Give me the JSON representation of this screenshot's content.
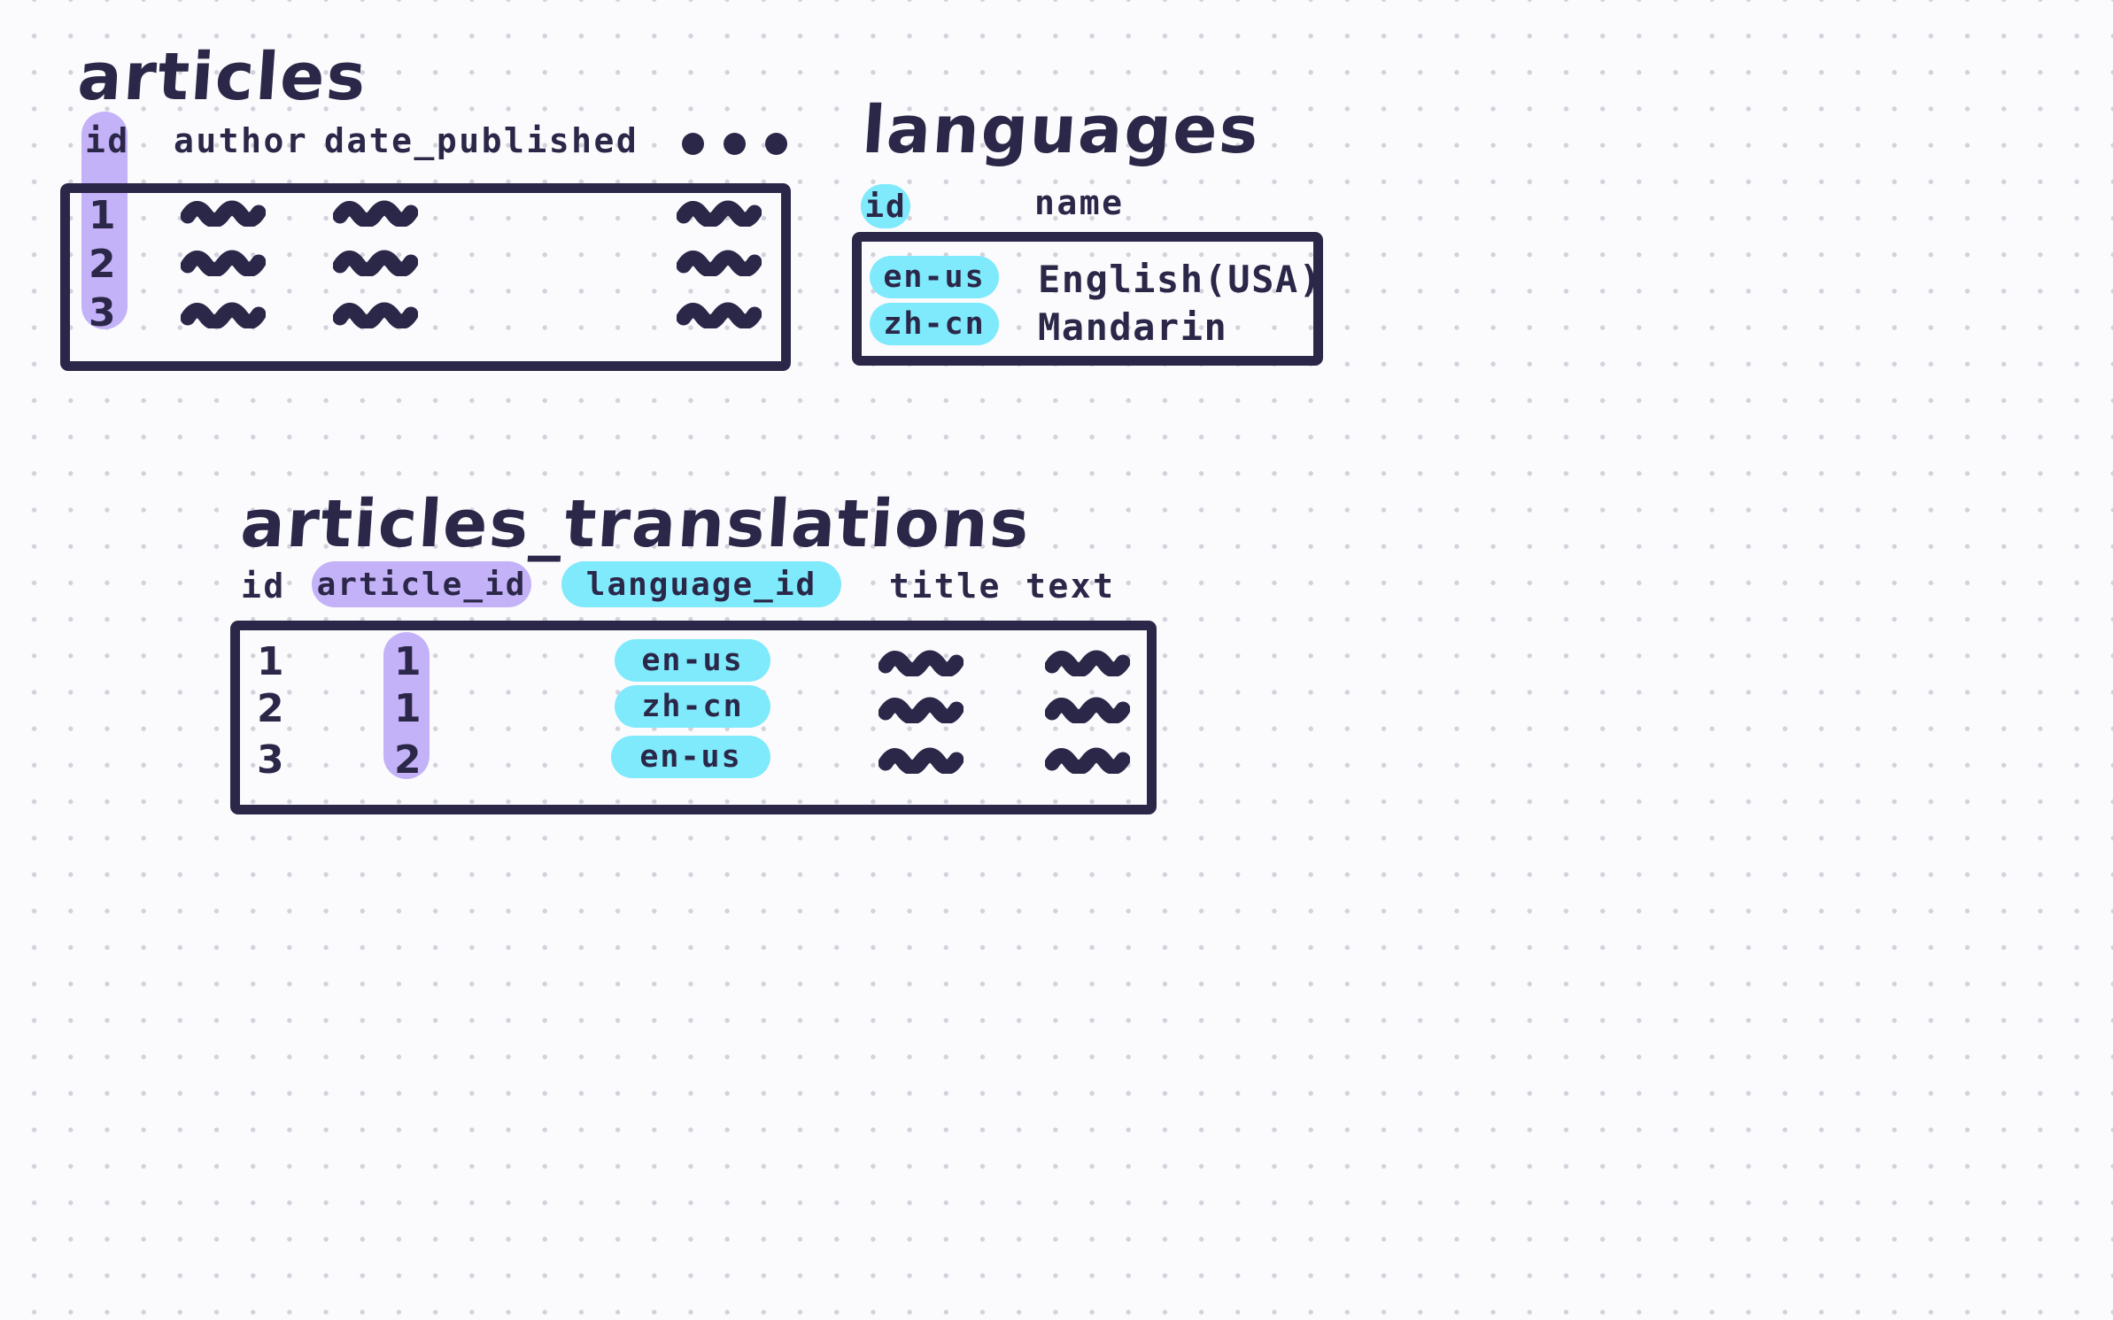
{
  "diagram": {
    "kind": "database-schema-sketch",
    "palette": {
      "ink": "#2b2748",
      "purple_highlight": "#c4b2f8",
      "cyan_highlight": "#7eeafc",
      "paper": "#fbfbfd",
      "grid_dot": "#d2d2dc"
    }
  },
  "tables": {
    "articles": {
      "title": "articles",
      "columns": [
        {
          "name": "id",
          "highlight": "purple"
        },
        {
          "name": "author",
          "highlight": "none"
        },
        {
          "name": "date_published",
          "highlight": "none"
        },
        {
          "name": "...",
          "highlight": "none"
        }
      ],
      "rows": [
        {
          "id": "1",
          "author": "~~~~",
          "date_published": "~~~~",
          "more": "~~~~"
        },
        {
          "id": "2",
          "author": "~~~~",
          "date_published": "~~~~",
          "more": "~~~~"
        },
        {
          "id": "3",
          "author": "~~~~",
          "date_published": "~~~~",
          "more": "~~~~"
        }
      ]
    },
    "languages": {
      "title": "languages",
      "columns": [
        {
          "name": "id",
          "highlight": "cyan"
        },
        {
          "name": "name",
          "highlight": "none"
        }
      ],
      "rows": [
        {
          "id": "en-us",
          "name": "English(USA)"
        },
        {
          "id": "zh-cn",
          "name": "Mandarin"
        }
      ]
    },
    "articles_translations": {
      "title": "articles_translations",
      "columns": [
        {
          "name": "id",
          "highlight": "none"
        },
        {
          "name": "article_id",
          "highlight": "purple"
        },
        {
          "name": "language_id",
          "highlight": "cyan"
        },
        {
          "name": "title",
          "highlight": "none"
        },
        {
          "name": "text",
          "highlight": "none"
        }
      ],
      "rows": [
        {
          "id": "1",
          "article_id": "1",
          "language_id": "en-us",
          "title": "~~~~",
          "text": "~~~~"
        },
        {
          "id": "2",
          "article_id": "1",
          "language_id": "zh-cn",
          "title": "~~~~",
          "text": "~~~~"
        },
        {
          "id": "3",
          "article_id": "2",
          "language_id": "en-us",
          "title": "~~~~",
          "text": "~~~~"
        }
      ]
    }
  }
}
